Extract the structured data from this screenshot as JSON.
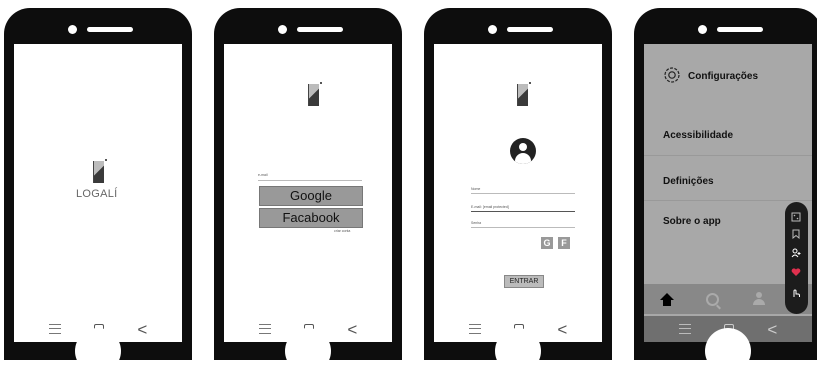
{
  "screens": {
    "splash": {
      "brand": "LOGALÍ"
    },
    "login": {
      "email_label": "e-mail",
      "google_label": "Google",
      "facebook_label": "Facabook",
      "footer_link": "criar conta"
    },
    "register": {
      "name_label": "Nome",
      "email_value": "E-mail: [email protected]",
      "password_label": "Senha",
      "google_short": "G",
      "facebook_short": "F",
      "enter_label": "ENTRAR"
    },
    "settings": {
      "title": "Configurações",
      "items": [
        "Acessibilidade",
        "Definições",
        "Sobre o app"
      ]
    }
  },
  "colors": {
    "heart": "#e0304e"
  }
}
